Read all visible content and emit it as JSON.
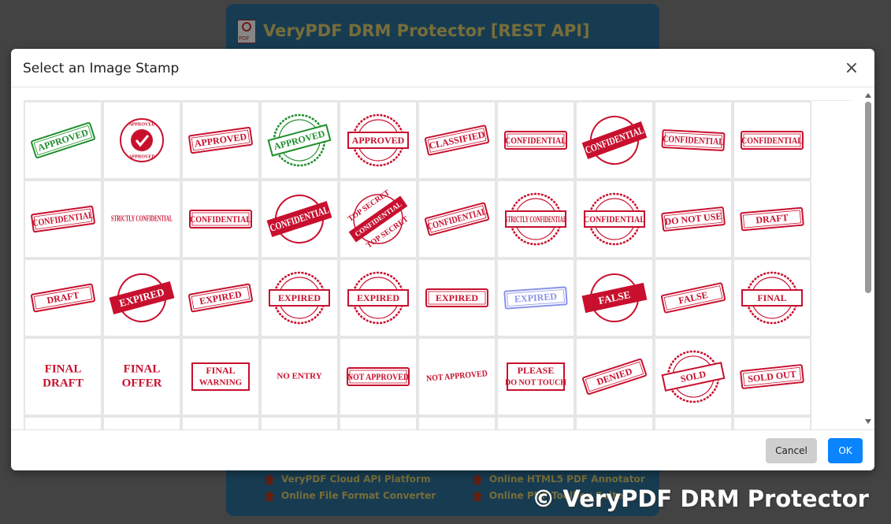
{
  "background": {
    "app_title": "VeryPDF DRM Protector [REST API]",
    "pdf_icon_label": "PDF",
    "links": [
      {
        "label": "VeryPDF Cloud API Platform"
      },
      {
        "label": "Online HTML5 PDF Annotator"
      },
      {
        "label": "Online File Format Converter"
      },
      {
        "label": "Online PDF Toolbox Suite"
      }
    ],
    "watermark": "© VeryPDF DRM Protector"
  },
  "modal": {
    "title": "Select an Image Stamp",
    "close_label": "×",
    "cancel_label": "Cancel",
    "ok_label": "OK"
  },
  "colors": {
    "red": "#c8102e",
    "green": "#1f8f2c",
    "blue": "#8a93e6",
    "ok_button": "#0a84ff"
  },
  "stamps": [
    {
      "name": "approved-green",
      "lines": [
        "APPROVED"
      ],
      "color": "#1f8f2c",
      "style": "rect",
      "rot": -18
    },
    {
      "name": "approved-check",
      "lines": [
        "APPROVED",
        "APPROVED"
      ],
      "color": "#c8102e",
      "style": "check",
      "rot": 0
    },
    {
      "name": "approved-red",
      "lines": [
        "APPROVED"
      ],
      "color": "#c8102e",
      "style": "rect",
      "rot": -8
    },
    {
      "name": "approved-green-seal",
      "lines": [
        "APPROVED"
      ],
      "color": "#1f8f2c",
      "style": "seal",
      "rot": -15
    },
    {
      "name": "approved-red-seal",
      "lines": [
        "APPROVED"
      ],
      "color": "#c8102e",
      "style": "seal",
      "rot": 0
    },
    {
      "name": "classified",
      "lines": [
        "CLASSIFIED"
      ],
      "color": "#c8102e",
      "style": "rect",
      "rot": -12
    },
    {
      "name": "confidential-1",
      "lines": [
        "CONFIDENTIAL"
      ],
      "color": "#c8102e",
      "style": "rect",
      "rot": 0
    },
    {
      "name": "confidential-2",
      "lines": [
        "CONFIDENTIAL"
      ],
      "color": "#c8102e",
      "style": "banner",
      "rot": -20
    },
    {
      "name": "confidential-3",
      "lines": [
        "CONFIDENTIAL"
      ],
      "color": "#c8102e",
      "style": "rect",
      "rot": 3
    },
    {
      "name": "confidential-4",
      "lines": [
        "CONFIDENTIAL"
      ],
      "color": "#c8102e",
      "style": "rect",
      "rot": 0
    },
    {
      "name": "confidential-5",
      "lines": [
        "CONFIDENTIAL"
      ],
      "color": "#c8102e",
      "style": "rect",
      "rot": -8
    },
    {
      "name": "strictly-confidential",
      "lines": [
        "STRICTLY CONFIDENTIAL"
      ],
      "color": "#c8102e",
      "style": "plain",
      "rot": 0
    },
    {
      "name": "confidential-6",
      "lines": [
        "CONFIDENTIAL"
      ],
      "color": "#c8102e",
      "style": "rect",
      "rot": 0
    },
    {
      "name": "confidential-7",
      "lines": [
        "CONFIDENTIAL"
      ],
      "color": "#c8102e",
      "style": "banner",
      "rot": -18
    },
    {
      "name": "top-secret",
      "lines": [
        "TOP SECRET",
        "CONFIDENTIAL",
        "TOP SECRET"
      ],
      "color": "#c8102e",
      "style": "topsecret",
      "rot": -35
    },
    {
      "name": "confidential-8",
      "lines": [
        "CONFIDENTIAL"
      ],
      "color": "#c8102e",
      "style": "rect",
      "rot": -15
    },
    {
      "name": "strictly-confidential-2",
      "lines": [
        "STRICTLY CONFIDENTIAL"
      ],
      "color": "#c8102e",
      "style": "seal",
      "rot": 0
    },
    {
      "name": "confidential-seal",
      "lines": [
        "CONFIDENTIAL"
      ],
      "color": "#c8102e",
      "style": "seal",
      "rot": 0
    },
    {
      "name": "do-not-use",
      "lines": [
        "DO NOT USE"
      ],
      "color": "#c8102e",
      "style": "rect",
      "rot": -6
    },
    {
      "name": "draft-1",
      "lines": [
        "DRAFT"
      ],
      "color": "#c8102e",
      "style": "rect",
      "rot": -5
    },
    {
      "name": "draft-2",
      "lines": [
        "DRAFT"
      ],
      "color": "#c8102e",
      "style": "rect",
      "rot": -10
    },
    {
      "name": "expired-1",
      "lines": [
        "EXPIRED"
      ],
      "color": "#c8102e",
      "style": "banner",
      "rot": -15
    },
    {
      "name": "expired-2",
      "lines": [
        "EXPIRED"
      ],
      "color": "#c8102e",
      "style": "rect",
      "rot": -10
    },
    {
      "name": "expired-seal-1",
      "lines": [
        "EXPIRED"
      ],
      "color": "#c8102e",
      "style": "seal",
      "rot": 0
    },
    {
      "name": "expired-seal-2",
      "lines": [
        "EXPIRED"
      ],
      "color": "#c8102e",
      "style": "seal",
      "rot": 0
    },
    {
      "name": "expired-3",
      "lines": [
        "EXPIRED"
      ],
      "color": "#c8102e",
      "style": "rect",
      "rot": 0
    },
    {
      "name": "expired-blue",
      "lines": [
        "EXPIRED"
      ],
      "color": "#8a93e6",
      "style": "rect",
      "rot": -4
    },
    {
      "name": "false-1",
      "lines": [
        "FALSE"
      ],
      "color": "#c8102e",
      "style": "banner",
      "rot": -12
    },
    {
      "name": "false-2",
      "lines": [
        "FALSE"
      ],
      "color": "#c8102e",
      "style": "rect",
      "rot": -12
    },
    {
      "name": "final-1",
      "lines": [
        "FINAL"
      ],
      "color": "#c8102e",
      "style": "seal",
      "rot": 0
    },
    {
      "name": "final-draft",
      "lines": [
        "FINAL",
        "DRAFT"
      ],
      "color": "#c8102e",
      "style": "plain2",
      "rot": 0
    },
    {
      "name": "final-offer",
      "lines": [
        "FINAL",
        "OFFER"
      ],
      "color": "#c8102e",
      "style": "plain2",
      "rot": 0
    },
    {
      "name": "final-warning",
      "lines": [
        "FINAL",
        "WARNING"
      ],
      "color": "#c8102e",
      "style": "rect2",
      "rot": 0
    },
    {
      "name": "no-entry",
      "lines": [
        "NO ENTRY"
      ],
      "color": "#c8102e",
      "style": "plain",
      "rot": 0
    },
    {
      "name": "not-approved-1",
      "lines": [
        "NOT APPROVED"
      ],
      "color": "#c8102e",
      "style": "rect",
      "rot": 0
    },
    {
      "name": "not-approved-2",
      "lines": [
        "NOT APPROVED"
      ],
      "color": "#c8102e",
      "style": "plain",
      "rot": -5
    },
    {
      "name": "please-do-not-touch",
      "lines": [
        "PLEASE",
        "DO NOT TOUCH"
      ],
      "color": "#c8102e",
      "style": "rect2",
      "rot": 0
    },
    {
      "name": "denied",
      "lines": [
        "DENIED"
      ],
      "color": "#c8102e",
      "style": "rect",
      "rot": -18
    },
    {
      "name": "sold",
      "lines": [
        "SOLD"
      ],
      "color": "#c8102e",
      "style": "seal",
      "rot": -12
    },
    {
      "name": "sold-out",
      "lines": [
        "SOLD OUT"
      ],
      "color": "#c8102e",
      "style": "rect",
      "rot": -6
    },
    {
      "name": "stamp-41",
      "lines": [],
      "color": "#c8102e",
      "style": "empty",
      "rot": 0
    },
    {
      "name": "stamp-42",
      "lines": [],
      "color": "#c8102e",
      "style": "empty",
      "rot": 0
    },
    {
      "name": "stamp-43",
      "lines": [],
      "color": "#c8102e",
      "style": "empty",
      "rot": 0
    },
    {
      "name": "stamp-44",
      "lines": [],
      "color": "#c8102e",
      "style": "empty",
      "rot": 0
    },
    {
      "name": "stamp-45",
      "lines": [],
      "color": "#c8102e",
      "style": "empty",
      "rot": 0
    },
    {
      "name": "stamp-46",
      "lines": [],
      "color": "#c8102e",
      "style": "empty",
      "rot": 0
    },
    {
      "name": "stamp-47",
      "lines": [],
      "color": "#c8102e",
      "style": "arc",
      "rot": 0
    },
    {
      "name": "stamp-48",
      "lines": [],
      "color": "#c8102e",
      "style": "empty",
      "rot": 0
    },
    {
      "name": "stamp-49",
      "lines": [],
      "color": "#c8102e",
      "style": "empty",
      "rot": 0
    },
    {
      "name": "stamp-50",
      "lines": [],
      "color": "#c8102e",
      "style": "arc",
      "rot": 0
    }
  ]
}
